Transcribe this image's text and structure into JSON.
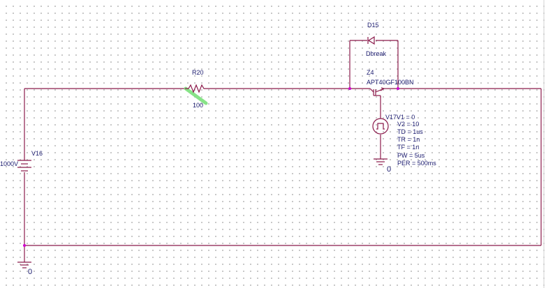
{
  "colors": {
    "wire": "#8b1a4b",
    "label": "#1a1a6e",
    "junction": "#d000d0",
    "selection": "#7be07b",
    "grid_dot": "#b9b9b9"
  },
  "components": {
    "r20": {
      "ref": "R20",
      "value": "100"
    },
    "d15": {
      "ref": "D15",
      "model": "Dbreak"
    },
    "z4": {
      "ref": "Z4",
      "model": "APT40GF100BN"
    },
    "v16": {
      "ref": "V16",
      "value": "1000V"
    },
    "v17": {
      "ref": "V17",
      "params": [
        "V1 = 0",
        "V2 = 10",
        "TD = 1us",
        "TR = 1n",
        "TF = 1n",
        "PW = 5us",
        "PER = 500ms"
      ]
    },
    "gnd_bottom": {
      "label": "0"
    },
    "gnd_gate": {
      "label": "0"
    }
  },
  "icons": [
    "resistor-symbol",
    "diode-symbol",
    "igbt-symbol",
    "dc-source-symbol",
    "pulse-source-symbol",
    "ground-symbol"
  ]
}
